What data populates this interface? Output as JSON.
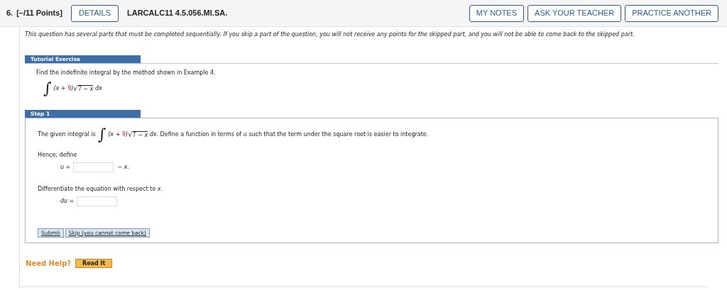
{
  "header": {
    "number": "6.",
    "points": "[–/11 Points]",
    "details_button": "DETAILS",
    "problem_id": "LARCALC11 4.5.056.MI.SA.",
    "buttons": [
      "MY NOTES",
      "ASK YOUR TEACHER",
      "PRACTICE ANOTHER"
    ]
  },
  "notice": "This question has several parts that must be completed sequentially. If you skip a part of the question, you will not receive any points for the skipped part, and you will not be able to come back to the skipped part.",
  "tutorial": {
    "title": "Tutorial Exercise",
    "instruction": "Find the indefinite integral by the method shown in Example 4.",
    "expression": [
      {
        "kind": "integral",
        "text": "∫"
      },
      {
        "kind": "math",
        "text": "(x + "
      },
      {
        "kind": "given",
        "text": "9"
      },
      {
        "kind": "math",
        "text": ")"
      },
      {
        "kind": "sqrt",
        "text": "√",
        "children": [
          {
            "kind": "given",
            "text": "7"
          },
          {
            "kind": "math",
            "text": " − x"
          }
        ]
      },
      {
        "kind": "math",
        "text": " dx"
      }
    ]
  },
  "step": {
    "title": "Step 1",
    "intro": "The given integral is",
    "expression": [
      {
        "kind": "integral",
        "text": "∫"
      },
      {
        "kind": "math",
        "text": "(x + "
      },
      {
        "kind": "given",
        "text": "9"
      },
      {
        "kind": "math",
        "text": ")"
      },
      {
        "kind": "sqrt",
        "text": "√",
        "children": [
          {
            "kind": "given",
            "text": "7"
          },
          {
            "kind": "math",
            "text": " − x"
          }
        ]
      },
      {
        "kind": "math",
        "text": " dx"
      }
    ],
    "after": ". Define a function in terms of *u* such that the term under the square root is easier to integrate.",
    "hence": "Hence, define",
    "u_label": "u =",
    "u_suffix": "− x.",
    "differentiate": "Differentiate the equation with respect to *x*.",
    "du_label": "du =",
    "submit": "Submit",
    "skip": "Skip (you cannot come back)"
  },
  "help": {
    "label": "Need Help?",
    "read_it": "Read It"
  }
}
